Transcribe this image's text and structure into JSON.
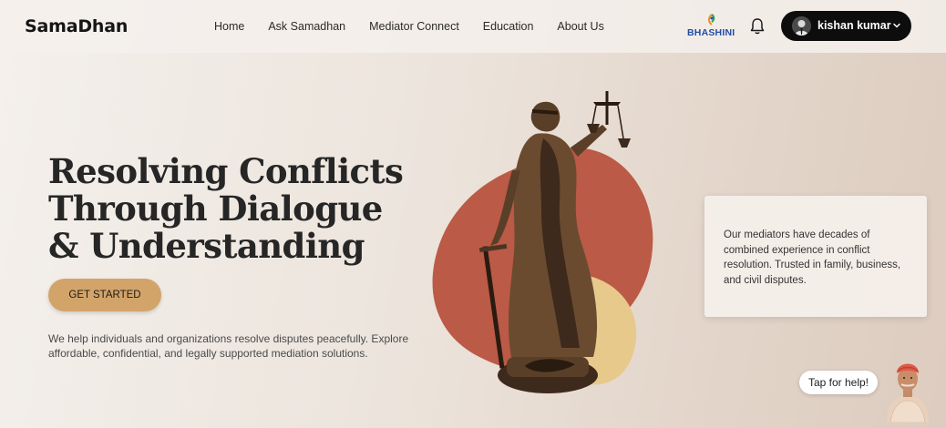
{
  "header": {
    "brand": "SamaDhan",
    "nav": [
      {
        "label": "Home"
      },
      {
        "label": "Ask Samadhan"
      },
      {
        "label": "Mediator Connect"
      },
      {
        "label": "Education"
      },
      {
        "label": "About Us"
      }
    ],
    "bhashini_label": "BHASHINI",
    "user": {
      "name": "kishan kumar"
    }
  },
  "hero": {
    "title_line1": "Resolving Conflicts",
    "title_line2": "Through Dialogue",
    "title_line3": "& Understanding",
    "cta_label": "GET STARTED",
    "description": "We help individuals and organizations resolve disputes peacefully. Explore affordable, confidential, and legally supported mediation solutions."
  },
  "info_card": {
    "text": "Our mediators have decades of combined experience in conflict resolution. Trusted in family, business, and civil disputes."
  },
  "help": {
    "bubble_text": "Tap for help!"
  },
  "colors": {
    "accent": "#d2a46a",
    "blob_red": "#bb5a46",
    "blob_yellow": "#e8c98c",
    "user_pill": "#0d0d0d",
    "bhashini_blue": "#1f4fa8"
  },
  "icons": [
    "bell-icon",
    "chevron-down-icon",
    "bhashini-logo-icon",
    "avatar"
  ]
}
